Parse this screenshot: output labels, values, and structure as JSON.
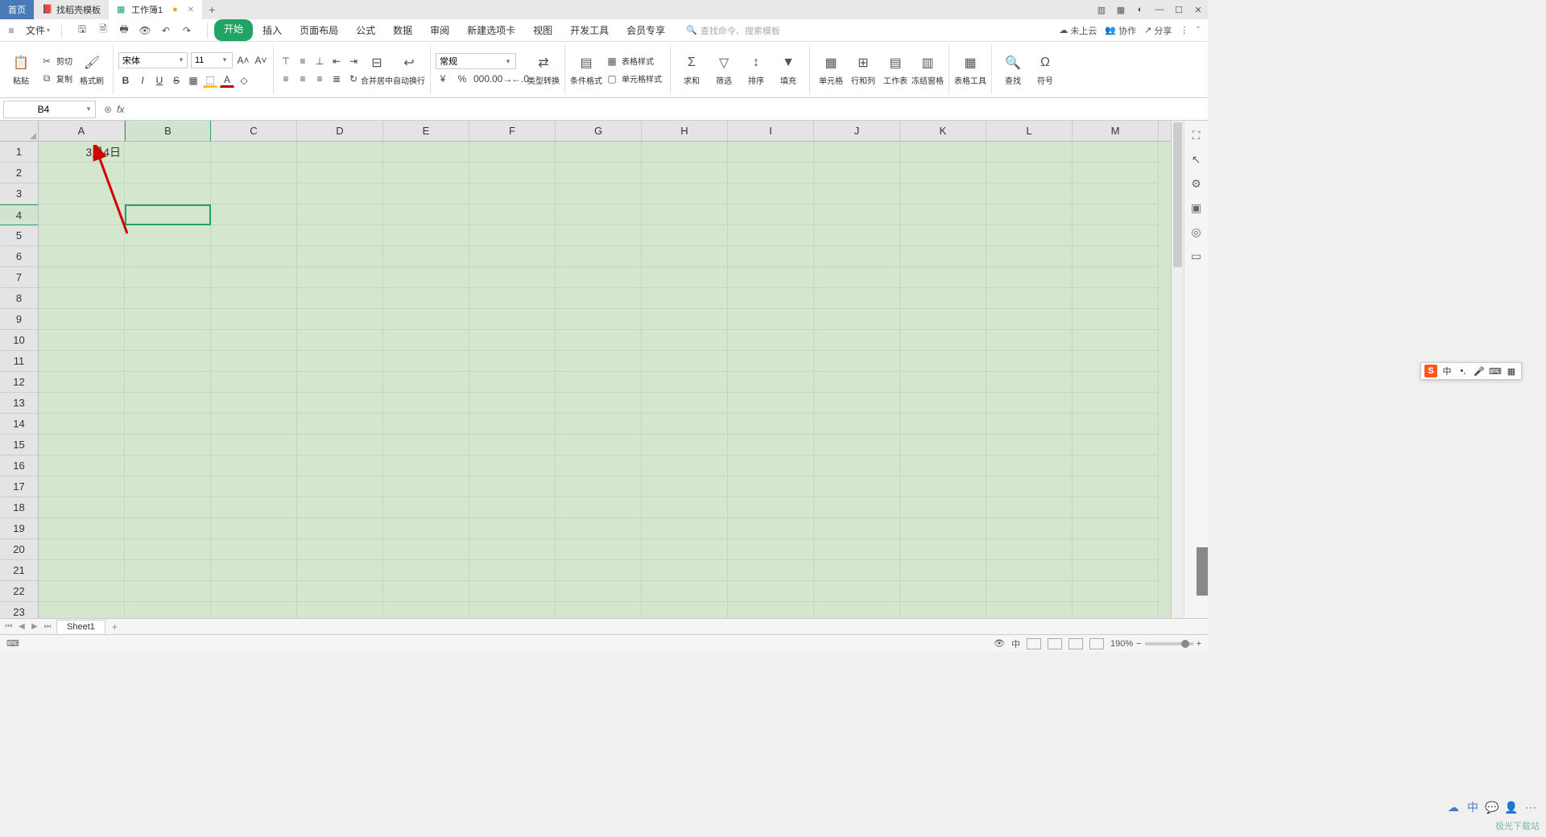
{
  "titlebar": {
    "home": "首页",
    "tab_template": "找稻壳模板",
    "tab_workbook": "工作簿1"
  },
  "win": {
    "min": "—",
    "max": "☐",
    "close": "✕",
    "appgrid": "▦",
    "person": "◐",
    "layers": "▥"
  },
  "menu": {
    "file": "文件",
    "tabs": [
      "开始",
      "插入",
      "页面布局",
      "公式",
      "数据",
      "审阅",
      "新建选项卡",
      "视图",
      "开发工具",
      "会员专享"
    ],
    "active_index": 0,
    "search_placeholder": "查找命令、搜索模板",
    "cloud": "未上云",
    "collab": "协作",
    "share": "分享"
  },
  "ribbon": {
    "paste": "粘贴",
    "cut": "剪切",
    "copy": "复制",
    "format_painter": "格式刷",
    "font_name": "宋体",
    "font_size": "11",
    "merge_center": "合并居中",
    "wrap_text": "自动换行",
    "number_format": "常规",
    "type_convert": "类型转换",
    "cond_format": "条件格式",
    "table_style": "表格样式",
    "cell_style": "单元格样式",
    "sum": "求和",
    "filter": "筛选",
    "sort": "排序",
    "fill": "填充",
    "cells": "单元格",
    "row_col": "行和列",
    "worksheet": "工作表",
    "freeze": "冻结窗格",
    "table_tools": "表格工具",
    "find": "查找",
    "symbol": "符号"
  },
  "formula_bar": {
    "name_box": "B4",
    "fx": "fx"
  },
  "grid": {
    "columns": [
      "A",
      "B",
      "C",
      "D",
      "E",
      "F",
      "G",
      "H",
      "I",
      "J",
      "K",
      "L",
      "M"
    ],
    "rows": [
      "1",
      "2",
      "3",
      "4",
      "5",
      "6",
      "7",
      "8",
      "9",
      "10",
      "11",
      "12",
      "13",
      "14",
      "15",
      "16",
      "17",
      "18",
      "19",
      "20",
      "21",
      "22",
      "23"
    ],
    "active_col": 1,
    "active_row": 3,
    "cell_A1": "3月4日"
  },
  "sheet": {
    "name": "Sheet1",
    "add": "+"
  },
  "status": {
    "ready": "⌨",
    "zoom": "190%",
    "zoom_minus": "−",
    "zoom_plus": "+"
  },
  "ime": {
    "logo": "S",
    "cn": "中",
    "voice": "🎤",
    "kbd": "⌨",
    "grid": "▦"
  },
  "watermark": "极光下载站"
}
